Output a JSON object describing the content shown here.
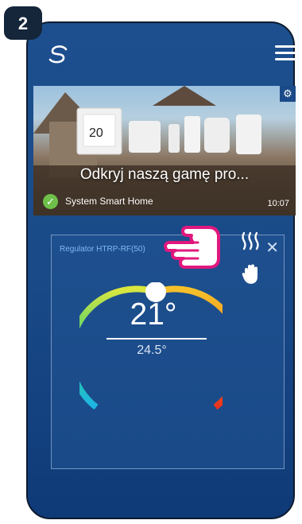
{
  "step": {
    "number": "2"
  },
  "header": {
    "logo_icon": "smart-home-logo",
    "menu_icon": "hamburger-menu-icon"
  },
  "banner": {
    "title": "Odkryj naszą gamę pro...",
    "label": "System Smart Home",
    "time": "10:07",
    "check_icon": "check-circle-icon",
    "gear_icon": "gear-icon",
    "thermostat_display": "20"
  },
  "device": {
    "title": "Regulator HTRP-RF(50)",
    "setpoint": "21°",
    "current_temperature": "24.5°",
    "heating_icon": "heating-icon",
    "manual_mode_icon": "hand-icon",
    "close_icon": "close-icon",
    "dial_level": 0.5
  },
  "colors": {
    "background": "#1a4a88",
    "card_title": "#7fbbf2",
    "check": "#6fc04a",
    "pointer": "#e0187e"
  }
}
